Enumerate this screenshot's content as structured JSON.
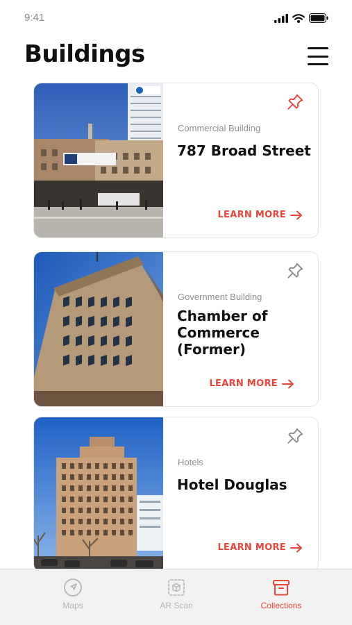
{
  "status_bar": {
    "time": "9:41"
  },
  "header": {
    "title": "Buildings",
    "menu_icon": "hamburger-menu-icon"
  },
  "cards": [
    {
      "category": "Commercial Building",
      "name": "787 Broad Street",
      "cta": "LEARN MORE",
      "pinned": true,
      "pin_color": "#e8463b"
    },
    {
      "category": "Government Building",
      "name": "Chamber of Commerce (Former)",
      "cta": "LEARN MORE",
      "pinned": false,
      "pin_color": "#8a8a8a"
    },
    {
      "category": "Hotels",
      "name": "Hotel Douglas",
      "cta": "LEARN MORE",
      "pinned": false,
      "pin_color": "#8a8a8a"
    }
  ],
  "tab_bar": {
    "tabs": [
      {
        "label": "Maps",
        "icon": "navigation-icon",
        "active": false
      },
      {
        "label": "AR Scan",
        "icon": "ar-scan-icon",
        "active": false
      },
      {
        "label": "Collections",
        "icon": "archive-box-icon",
        "active": true
      }
    ]
  },
  "colors": {
    "accent": "#e8463b",
    "inactive": "#b3b3b3",
    "text": "#111111",
    "muted": "#8d8d8d"
  }
}
